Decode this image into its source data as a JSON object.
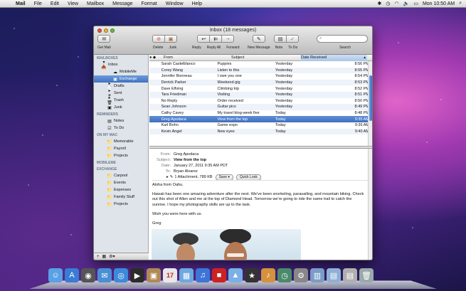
{
  "menubar": {
    "apple": "",
    "items": [
      "Mail",
      "File",
      "Edit",
      "View",
      "Mailbox",
      "Message",
      "Format",
      "Window",
      "Help"
    ],
    "clock": "Mon 10:50 AM"
  },
  "window": {
    "title": "Inbox (18 messages)",
    "toolbar": {
      "get_mail": "Get Mail",
      "delete": "Delete",
      "junk": "Junk",
      "reply": "Reply",
      "reply_all": "Reply All",
      "forward": "Forward",
      "new_message": "New Message",
      "note": "Note",
      "todo": "To Do",
      "search_label": "Search",
      "search_placeholder": ""
    }
  },
  "sidebar": {
    "mailboxes_head": "MAILBOXES",
    "inbox": "Inbox",
    "mobileme": "MobileMe",
    "exchange_sub": "Exchange",
    "drafts": "Drafts",
    "sent": "Sent",
    "trash": "Trash",
    "junk": "Junk",
    "reminders_head": "REMINDERS",
    "notes": "Notes",
    "todo": "To Do",
    "onmymac_head": "ON MY MAC",
    "memorable": "Memorable",
    "payroll": "Payroll",
    "projects": "Projects",
    "mobileme_head": "MOBILEME",
    "exchange_head": "EXCHANGE",
    "carpool": "Carpool",
    "events": "Events",
    "expenses": "Expenses",
    "family": "Family Stuff",
    "projects2": "Projects"
  },
  "list": {
    "col_from": "From",
    "col_subject": "Subject",
    "col_date": "Date Received",
    "rows": [
      {
        "from": "Sarah Castelblanco",
        "subject": "Puppies",
        "date": "Yesterday",
        "time": "8:56 PM"
      },
      {
        "from": "Corey Wang",
        "subject": "Listen to this",
        "date": "Yesterday",
        "time": "8:55 PM"
      },
      {
        "from": "Jennifer Bonneau",
        "subject": "I owe you one",
        "date": "Yesterday",
        "time": "8:54 PM"
      },
      {
        "from": "Derrick Parker",
        "subject": "Weekend gig",
        "date": "Yesterday",
        "time": "8:53 PM"
      },
      {
        "from": "Dave Elfving",
        "subject": "Climbing trip",
        "date": "Yesterday",
        "time": "8:52 PM"
      },
      {
        "from": "Tara Friedman",
        "subject": "Visiting",
        "date": "Yesterday",
        "time": "8:51 PM"
      },
      {
        "from": "No Reply",
        "subject": "Order received",
        "date": "Yesterday",
        "time": "8:50 PM"
      },
      {
        "from": "Sean Johnson",
        "subject": "Guitar pics",
        "date": "Yesterday",
        "time": "8:49 PM"
      },
      {
        "from": "Cathy Cavey",
        "subject": "My travel blog-week five",
        "date": "Today",
        "time": "8:48 PM"
      },
      {
        "from": "Greg Apodaca",
        "subject": "View from the top",
        "date": "Today",
        "time": "9:35 AM"
      },
      {
        "from": "Karl Bohn",
        "subject": "Game expo",
        "date": "Today",
        "time": "9:36 AM"
      },
      {
        "from": "Kevin Angel",
        "subject": "New eyes",
        "date": "Today",
        "time": "9:40 AM"
      }
    ],
    "selected_index": 9
  },
  "preview": {
    "from_label": "From:",
    "from": "Greg Apodaca",
    "subject_label": "Subject:",
    "subject": "View from the top",
    "date_label": "Date:",
    "date": "January 27, 2011 9:35 AM PDT",
    "to_label": "To:",
    "to": "Bryan Alvarez",
    "attachment": "1 Attachment, 789 KB",
    "save": "Save",
    "quick_look": "Quick Look",
    "greeting": "Aloha from Oahu.",
    "para1": "Hawaii has been one amazing adventure after the next. We've been snorkeling, parasailing, and mountain biking. Check out this shot of Allen and me at the top of Diamond Head. Tomorrow we're going to ride the same trail to catch the sunrise. I hope my photography skills are up to the task.",
    "para2": "Wish you were here with us.",
    "signoff": "Greg"
  },
  "dock": {
    "icons": [
      "finder-icon",
      "app-store-icon",
      "dashboard-icon",
      "mail-icon",
      "safari-icon",
      "facetime-icon",
      "contacts-icon",
      "calendar-icon",
      "preview-icon",
      "itunes-icon",
      "photo-booth-icon",
      "iphoto-icon",
      "imovie-icon",
      "garageband-icon",
      "time-machine-icon",
      "system-preferences-icon",
      "applications-folder-icon",
      "documents-folder-icon",
      "downloads-icon",
      "trash-icon"
    ],
    "calendar_day": "17"
  }
}
